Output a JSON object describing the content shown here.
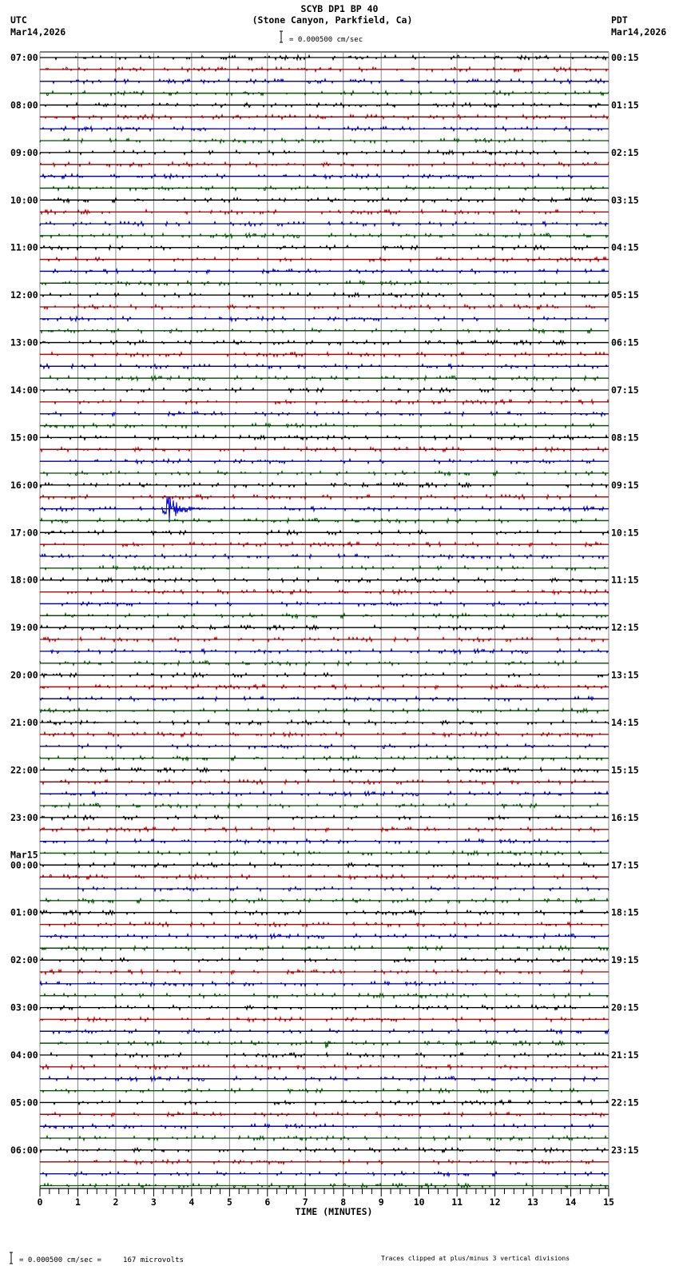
{
  "chart_data": {
    "type": "line",
    "title": "SCYB DP1 BP 40",
    "subtitle": "(Stone Canyon, Parkfield, Ca)",
    "scale_label": "= 0.000500 cm/sec",
    "left_tz": "UTC",
    "left_date": "Mar14,2026",
    "right_tz": "PDT",
    "right_date": "Mar14,2026",
    "left_hours": [
      "07:00",
      "08:00",
      "09:00",
      "10:00",
      "11:00",
      "12:00",
      "13:00",
      "14:00",
      "15:00",
      "16:00",
      "17:00",
      "18:00",
      "19:00",
      "20:00",
      "21:00",
      "22:00",
      "23:00",
      "00:00",
      "01:00",
      "02:00",
      "03:00",
      "04:00",
      "05:00",
      "06:00"
    ],
    "left_date_change": {
      "label": "Mar15",
      "before_hour": "00:00"
    },
    "right_hours": [
      "00:15",
      "01:15",
      "02:15",
      "03:15",
      "04:15",
      "05:15",
      "06:15",
      "07:15",
      "08:15",
      "09:15",
      "10:15",
      "11:15",
      "12:15",
      "13:15",
      "14:15",
      "15:15",
      "16:15",
      "17:15",
      "18:15",
      "19:15",
      "20:15",
      "21:15",
      "22:15",
      "23:15"
    ],
    "traces_per_hour": 4,
    "trace_colors": [
      "#000000",
      "#dd0000",
      "#0000dd",
      "#006600"
    ],
    "xlabel": "TIME (MINUTES)",
    "xlim": [
      0,
      15
    ],
    "xticks": [
      "0",
      "1",
      "2",
      "3",
      "4",
      "5",
      "6",
      "7",
      "8",
      "9",
      "10",
      "11",
      "12",
      "13",
      "14",
      "15"
    ],
    "events": [
      {
        "utc_trace": "16:30",
        "minute": 3.2,
        "amplitude_divisions": 3,
        "duration_min": 1.6,
        "color": "blue"
      },
      {
        "utc_trace": "17:00",
        "minute": 5.4,
        "amplitude_divisions": 0.3,
        "duration_min": 0.4,
        "color": "black"
      },
      {
        "utc_trace": "03:45",
        "minute": 7.5,
        "amplitude_divisions": 1,
        "duration_min": 0.6,
        "color": "green"
      },
      {
        "utc_trace": "03:00",
        "minute": 1.6,
        "amplitude_divisions": 0.2,
        "duration_min": 0.4,
        "color": "black"
      },
      {
        "utc_trace": "21:00",
        "minute": 1.4,
        "amplitude_divisions": 0.2,
        "duration_min": 0.4,
        "color": "black"
      }
    ],
    "footer_scale": "= 0.000500 cm/sec =     167 microvolts",
    "footer_note": "Traces clipped at plus/minus 3 vertical divisions"
  }
}
